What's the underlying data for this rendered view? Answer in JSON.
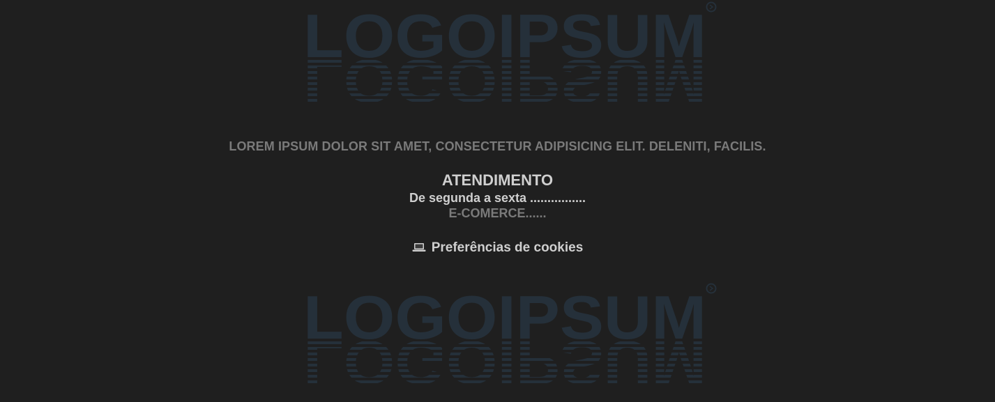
{
  "logo": {
    "text": "LOGOIPSUM",
    "color": "#25303a"
  },
  "footer": {
    "tagline": "LOREM IPSUM DOLOR SIT AMET, CONSECTETUR ADIPISICING ELIT. DELENITI, FACILIS.",
    "atendimento_title": "ATENDIMENTO",
    "atendimento_hours": "De segunda a sexta ................",
    "ecommerce": "E-COMERCE......",
    "cookies_label": "Preferências de cookies",
    "cookies_icon": "laptop-icon"
  },
  "colors": {
    "background": "#1f1f1f",
    "text_light": "#cfcfcf",
    "text_muted": "#7a7a7a"
  }
}
